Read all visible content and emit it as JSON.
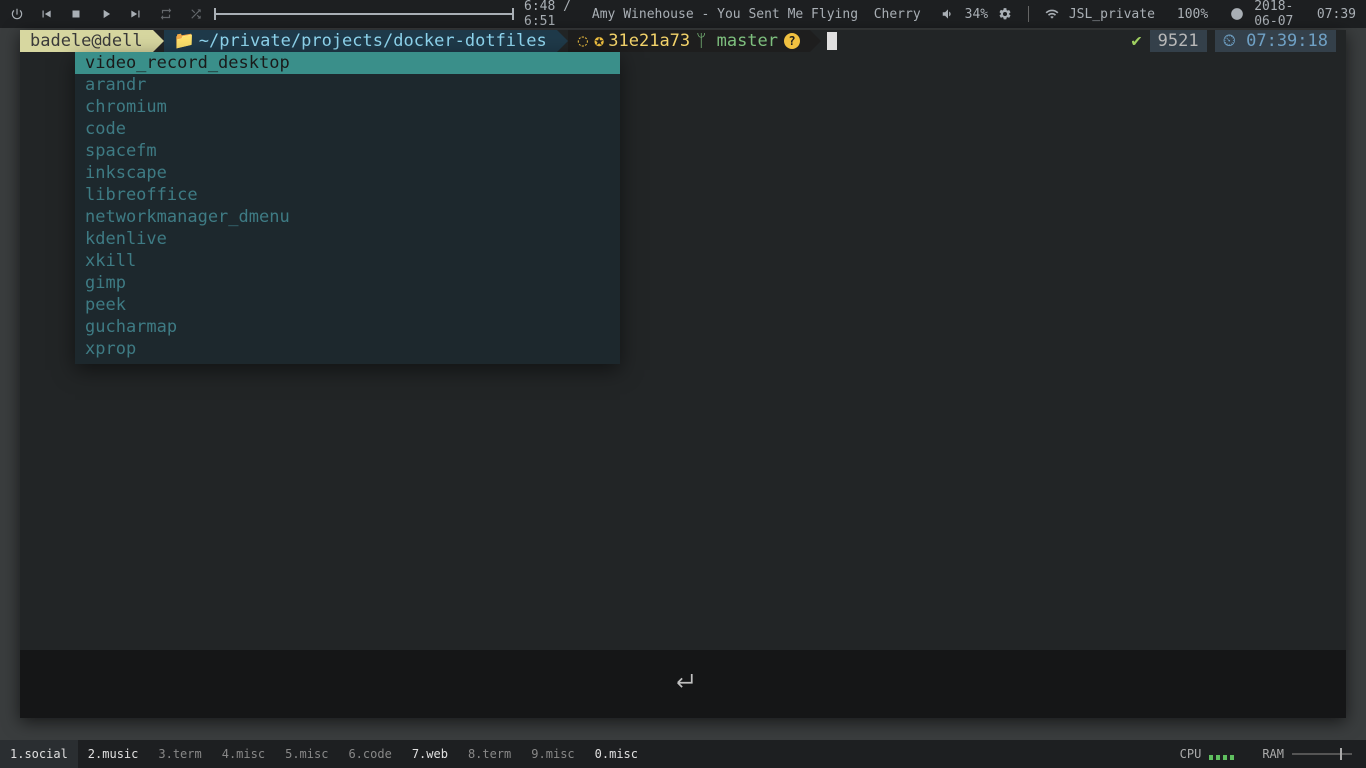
{
  "topbar": {
    "media_time": "6:48 / 6:51",
    "song_artist": "Amy Winehouse",
    "song_title": "You Sent Me Flying",
    "song_extra": "Cherry",
    "volume_pct": "34%",
    "wifi_ssid": "JSL_private",
    "battery_pct": "100%",
    "date": "2018-06-07",
    "time": "07:39"
  },
  "prompt": {
    "user": "badele@dell",
    "path": "~/private/projects/docker-dotfiles",
    "git_hash": "31e21a73",
    "git_branch": "master",
    "right_num": "9521",
    "right_time": "07:39:18"
  },
  "launcher": {
    "items": [
      "video_record_desktop",
      "arandr",
      "chromium",
      "code",
      "spacefm",
      "inkscape",
      "libreoffice",
      "networkmanager_dmenu",
      "kdenlive",
      "xkill",
      "gimp",
      "peek",
      "gucharmap",
      "xprop"
    ],
    "selected_index": 0
  },
  "workspaces": [
    {
      "label": "1.social",
      "state": "active"
    },
    {
      "label": "2.music",
      "state": "lit"
    },
    {
      "label": "3.term",
      "state": ""
    },
    {
      "label": "4.misc",
      "state": ""
    },
    {
      "label": "5.misc",
      "state": ""
    },
    {
      "label": "6.code",
      "state": ""
    },
    {
      "label": "7.web",
      "state": "lit"
    },
    {
      "label": "8.term",
      "state": ""
    },
    {
      "label": "9.misc",
      "state": ""
    },
    {
      "label": "0.misc",
      "state": "lit"
    }
  ],
  "sysmon": {
    "cpu_label": "CPU",
    "ram_label": "RAM"
  }
}
